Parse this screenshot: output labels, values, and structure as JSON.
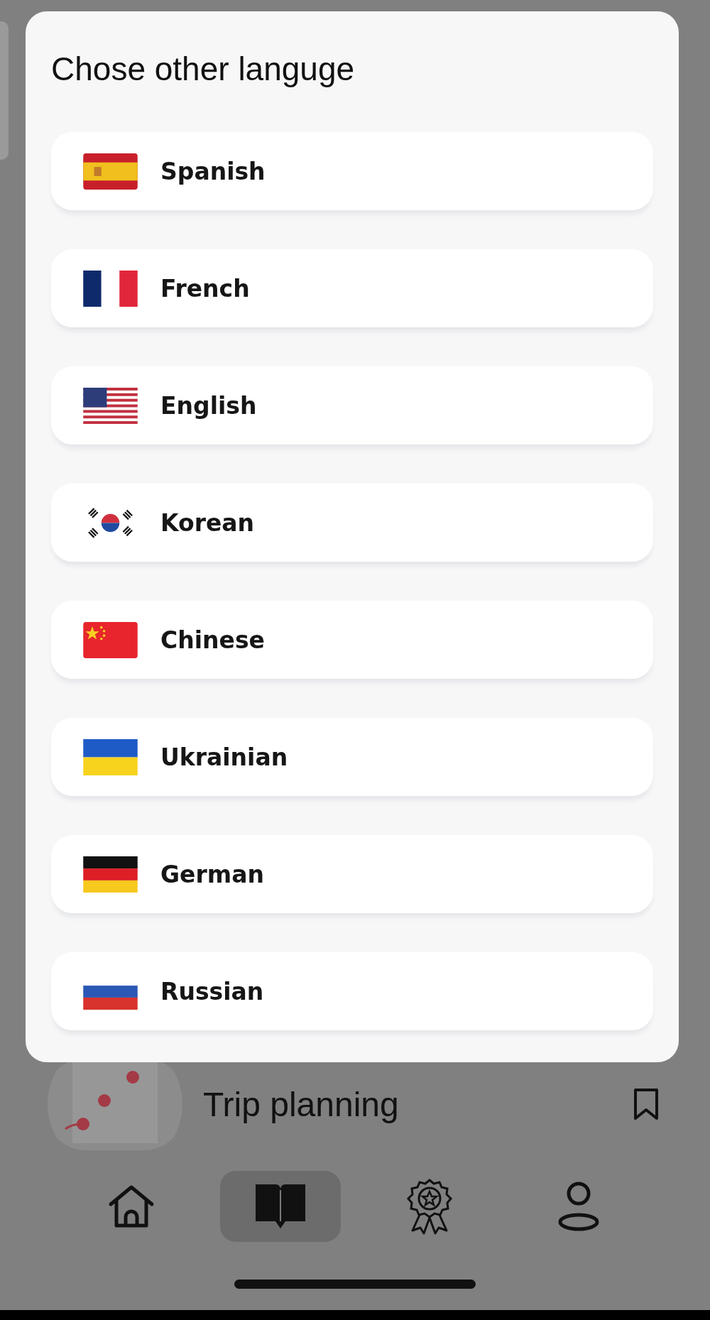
{
  "dialog": {
    "title": "Chose other languge",
    "languages": [
      {
        "label": "Spanish",
        "kind": "es"
      },
      {
        "label": "French",
        "kind": "fr"
      },
      {
        "label": "English",
        "kind": "us"
      },
      {
        "label": "Korean",
        "kind": "kr"
      },
      {
        "label": "Chinese",
        "kind": "cn"
      },
      {
        "label": "Ukrainian",
        "kind": "ua"
      },
      {
        "label": "German",
        "kind": "de"
      },
      {
        "label": "Russian",
        "kind": "ru"
      }
    ]
  },
  "background": {
    "card_title": "Trip planning"
  },
  "nav": [
    {
      "kind": "home",
      "selected": false
    },
    {
      "kind": "book",
      "selected": true
    },
    {
      "kind": "award",
      "selected": false
    },
    {
      "kind": "profile",
      "selected": false
    }
  ]
}
